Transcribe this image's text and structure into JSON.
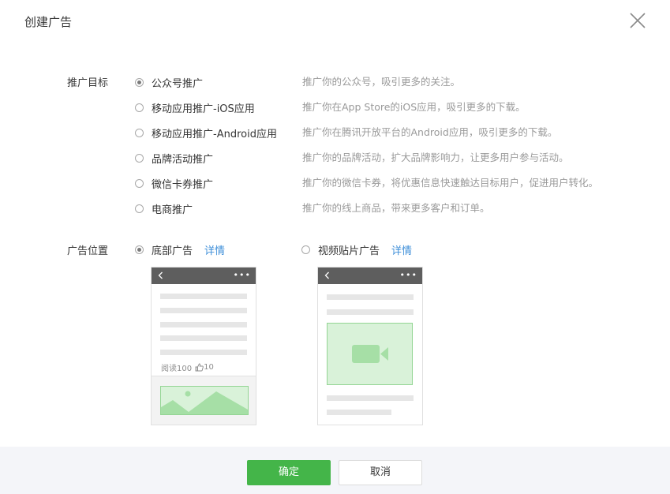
{
  "dialog": {
    "title": "创建广告",
    "close_icon": "close-icon"
  },
  "target": {
    "label": "推广目标",
    "options": [
      {
        "label": "公众号推广",
        "desc": "推广你的公众号，吸引更多的关注。",
        "checked": true
      },
      {
        "label": "移动应用推广-iOS应用",
        "desc": "推广你在App Store的iOS应用，吸引更多的下载。",
        "checked": false
      },
      {
        "label": "移动应用推广-Android应用",
        "desc": "推广你在腾讯开放平台的Android应用，吸引更多的下载。",
        "checked": false
      },
      {
        "label": "品牌活动推广",
        "desc": "推广你的品牌活动，扩大品牌影响力，让更多用户参与活动。",
        "checked": false
      },
      {
        "label": "微信卡券推广",
        "desc": "推广你的微信卡券，将优惠信息快速触达目标用户，促进用户转化。",
        "checked": false
      },
      {
        "label": "电商推广",
        "desc": "推广你的线上商品，带来更多客户和订单。",
        "checked": false
      }
    ]
  },
  "position": {
    "label": "广告位置",
    "options": [
      {
        "label": "底部广告",
        "detail": "详情",
        "checked": true
      },
      {
        "label": "视频贴片广告",
        "detail": "详情",
        "checked": false
      }
    ],
    "bottom_preview": {
      "read_label": "阅读100",
      "like_count": "10",
      "more": "•••"
    },
    "video_preview": {
      "more": "•••"
    }
  },
  "footer": {
    "confirm": "确定",
    "cancel": "取消"
  }
}
